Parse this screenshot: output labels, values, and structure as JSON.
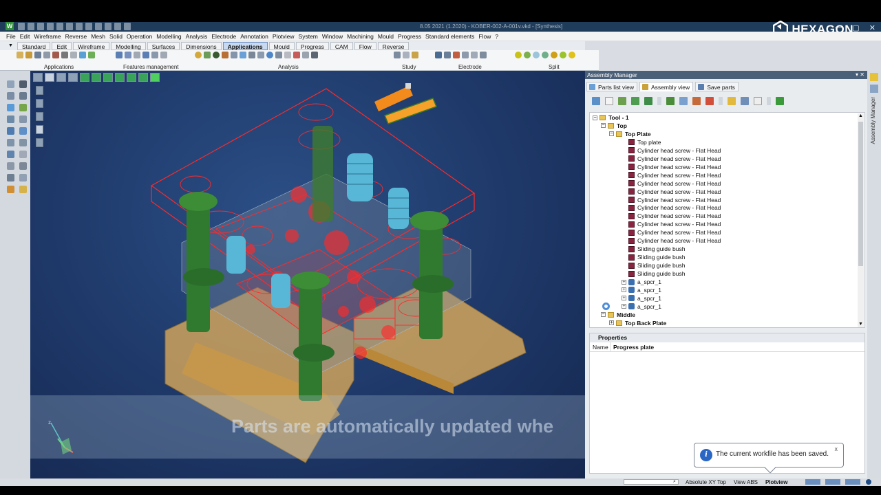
{
  "app": {
    "title": "8.05 2021 (1.2020) - KOBER-002-A-001v.vkd - [Synthesis]",
    "brand": "HEXAGON",
    "window_controls": [
      "—",
      "▢",
      "✕"
    ]
  },
  "menu": [
    "File",
    "Edit",
    "Wireframe",
    "Reverse",
    "Mesh",
    "Solid",
    "Operation",
    "Modelling",
    "Analysis",
    "Electrode",
    "Annotation",
    "Plotview",
    "System",
    "Window",
    "Machining",
    "Mould",
    "Progress",
    "Standard elements",
    "Flow",
    "?"
  ],
  "ribbon_tabs": [
    {
      "label": "Standard",
      "active": false
    },
    {
      "label": "Edit",
      "active": false
    },
    {
      "label": "Wireframe",
      "active": false
    },
    {
      "label": "Modelling",
      "active": false
    },
    {
      "label": "Surfaces",
      "active": false
    },
    {
      "label": "Dimensions",
      "active": false
    },
    {
      "label": "Applications",
      "active": true
    },
    {
      "label": "Mould",
      "active": false
    },
    {
      "label": "Progress",
      "active": false
    },
    {
      "label": "CAM",
      "active": false
    },
    {
      "label": "Flow",
      "active": false
    },
    {
      "label": "Reverse",
      "active": false
    }
  ],
  "ribbon_groups": [
    "Applications",
    "Features management",
    "Analysis",
    "Study",
    "Electrode",
    "Split"
  ],
  "viewport": {
    "subtitle": "Parts are automatically updated whe",
    "axis_labels": {
      "z": "z"
    }
  },
  "assembly_manager": {
    "title": "Assembly Manager",
    "header_buttons": "▾ ✕",
    "tabs": [
      {
        "label": "Parts list view",
        "active": false
      },
      {
        "label": "Assembly view",
        "active": true
      },
      {
        "label": "Save parts",
        "active": false
      }
    ],
    "side_label": "Assembly Manager",
    "tree": [
      {
        "label": "Tool - 1",
        "indent": 0,
        "kind": "folder",
        "bold": true,
        "exp": "−"
      },
      {
        "label": "Top",
        "indent": 1,
        "kind": "folder",
        "bold": true,
        "exp": "−"
      },
      {
        "label": "Top Plate",
        "indent": 2,
        "kind": "folder",
        "bold": true,
        "exp": "−"
      },
      {
        "label": "Top plate",
        "indent": 3,
        "kind": "part",
        "bold": false
      },
      {
        "label": "Cylinder head screw - Flat Head",
        "indent": 3,
        "kind": "part",
        "bold": false
      },
      {
        "label": "Cylinder head screw - Flat Head",
        "indent": 3,
        "kind": "part",
        "bold": false
      },
      {
        "label": "Cylinder head screw - Flat Head",
        "indent": 3,
        "kind": "part",
        "bold": false
      },
      {
        "label": "Cylinder head screw - Flat Head",
        "indent": 3,
        "kind": "part",
        "bold": false
      },
      {
        "label": "Cylinder head screw - Flat Head",
        "indent": 3,
        "kind": "part",
        "bold": false
      },
      {
        "label": "Cylinder head screw - Flat Head",
        "indent": 3,
        "kind": "part",
        "bold": false
      },
      {
        "label": "Cylinder head screw - Flat Head",
        "indent": 3,
        "kind": "part",
        "bold": false
      },
      {
        "label": "Cylinder head screw - Flat Head",
        "indent": 3,
        "kind": "part",
        "bold": false
      },
      {
        "label": "Cylinder head screw - Flat Head",
        "indent": 3,
        "kind": "part",
        "bold": false
      },
      {
        "label": "Cylinder head screw - Flat Head",
        "indent": 3,
        "kind": "part",
        "bold": false
      },
      {
        "label": "Cylinder head screw - Flat Head",
        "indent": 3,
        "kind": "part",
        "bold": false
      },
      {
        "label": "Cylinder head screw - Flat Head",
        "indent": 3,
        "kind": "part",
        "bold": false
      },
      {
        "label": "Sliding guide bush",
        "indent": 3,
        "kind": "part",
        "bold": false
      },
      {
        "label": "Sliding guide bush",
        "indent": 3,
        "kind": "part",
        "bold": false
      },
      {
        "label": "Sliding guide bush",
        "indent": 3,
        "kind": "part",
        "bold": false
      },
      {
        "label": "Sliding guide bush",
        "indent": 3,
        "kind": "part",
        "bold": false
      },
      {
        "label": "a_spcr_1",
        "indent": 3,
        "kind": "assembly",
        "bold": false,
        "exp": "+"
      },
      {
        "label": "a_spcr_1",
        "indent": 3,
        "kind": "assembly",
        "bold": false,
        "exp": "+"
      },
      {
        "label": "a_spcr_1",
        "indent": 3,
        "kind": "assembly",
        "bold": false,
        "exp": "+"
      },
      {
        "label": "a_spcr_1",
        "indent": 3,
        "kind": "assembly",
        "bold": false,
        "exp": "+"
      },
      {
        "label": "Middle",
        "indent": 1,
        "kind": "folder",
        "bold": true,
        "exp": "−"
      },
      {
        "label": "Top Back Plate",
        "indent": 2,
        "kind": "folder",
        "bold": true,
        "exp": "+"
      }
    ],
    "properties": {
      "title": "Properties",
      "rows": [
        {
          "key": "Name",
          "value": "Progress plate"
        }
      ]
    }
  },
  "toast": {
    "message": "The current workfile has been saved.",
    "close": "x",
    "icon": "i"
  },
  "status": {
    "view_mode": "Absolute XY Top",
    "view_abs": "View ABS",
    "plotview": "Plotview"
  },
  "colors": {
    "accent": "#2a66c3",
    "viewport_bg": "#1e3868",
    "wireframe": "#ff2a2a",
    "columns": "#2f7a2f",
    "base_blocks": "#d9a95a"
  }
}
